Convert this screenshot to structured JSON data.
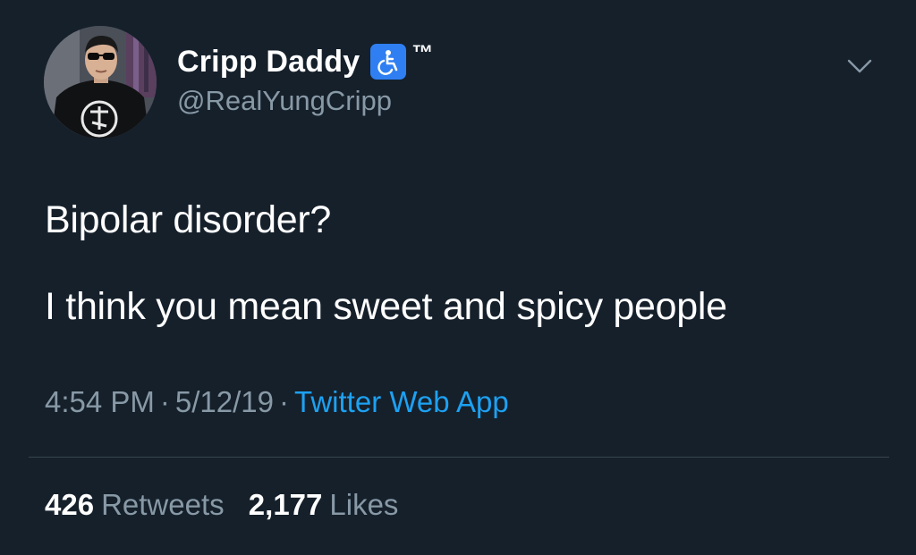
{
  "user": {
    "display_name": "Cripp Daddy",
    "badge_icon": "wheelchair-icon",
    "tm": "™",
    "handle": "@RealYungCripp",
    "avatar_icon": "user-avatar"
  },
  "tweet": {
    "lines": [
      "Bipolar disorder?",
      "I think you mean sweet and spicy people"
    ],
    "time": "4:54 PM",
    "separator": "·",
    "date": "5/12/19",
    "source": "Twitter Web App"
  },
  "stats": {
    "retweets": {
      "count": "426",
      "label": "Retweets"
    },
    "likes": {
      "count": "2,177",
      "label": "Likes"
    }
  },
  "colors": {
    "background": "#15202b",
    "secondary_text": "#8899a6",
    "link": "#1da1f2",
    "badge": "#2f7ff2",
    "divider": "#38444d"
  }
}
